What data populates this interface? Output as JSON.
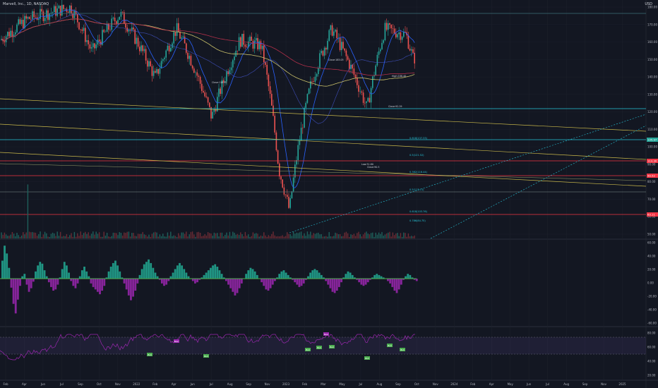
{
  "header": {
    "title": "Marvell, Inc., 1D, NASDAQ",
    "currency": "USD"
  },
  "chart_data": {
    "type": "candlestick",
    "title": "Marvell, Inc., 1D, NASDAQ",
    "x_ticks": [
      "Feb",
      "Apr",
      "Jun",
      "Jul",
      "Sep",
      "Oct",
      "Nov",
      "2022",
      "Feb",
      "Apr",
      "Jun",
      "Jul",
      "Aug",
      "Sep",
      "Nov",
      "2023",
      "Feb",
      "Mar",
      "May",
      "Jul",
      "Aug",
      "Sep",
      "Oct",
      "Nov",
      "2024",
      "Feb",
      "Apr",
      "May",
      "Jun",
      "Jul",
      "Aug",
      "Sep",
      "Nov",
      "2025"
    ],
    "y_axis": {
      "ticks": [
        "180.00",
        "170.00",
        "160.00",
        "150.00",
        "140.00",
        "130.00",
        "120.00",
        "110.00",
        "100.00",
        "90.00",
        "80.00",
        "70.00",
        "60.00",
        "50.00"
      ],
      "scale": "log"
    },
    "price_labels": [
      {
        "text": "135.97",
        "color": "#26a69a"
      },
      {
        "text": "113.30",
        "color": "#f23645"
      },
      {
        "text": "99.52",
        "color": "#f23645"
      },
      {
        "text": "63.11",
        "color": "#f23645"
      }
    ],
    "fib_labels": [
      "0.618(137.33)",
      "0.5(121.52)",
      "0.382(116.44)",
      "0.5(113.11)",
      "0.618(103.76)",
      "0.786(84.75)"
    ],
    "annotations": [
      "Close:183.05",
      "High:186.40",
      "Low:31.80",
      "Close:118.92",
      "Close:90.5",
      "Close:92.29"
    ],
    "macd": {
      "ticks": [
        "60.00",
        "40.00",
        "20.00",
        "0.00",
        "-20.00",
        "-40.00",
        "-60.00"
      ],
      "histogram": [
        30,
        55,
        42,
        18,
        -15,
        -42,
        -58,
        -35,
        -12,
        4,
        8,
        -10,
        -22,
        -16,
        -5,
        12,
        22,
        28,
        25,
        14,
        4,
        -6,
        -14,
        -20,
        -18,
        -10,
        2,
        16,
        28,
        22,
        10,
        -4,
        -12,
        -16,
        -8,
        4,
        14,
        20,
        12,
        4,
        -8,
        -14,
        -18,
        -22,
        -26,
        -20,
        -12,
        2,
        12,
        20,
        26,
        30,
        22,
        12,
        2,
        -8,
        -18,
        -28,
        -36,
        -30,
        -20,
        -8,
        6,
        16,
        24,
        28,
        32,
        26,
        18,
        10,
        4,
        -2,
        -8,
        -12,
        -10,
        -4,
        4,
        10,
        16,
        22,
        26,
        22,
        16,
        10,
        4,
        0,
        -4,
        -8,
        -6,
        -2,
        2,
        6,
        10,
        14,
        18,
        22,
        24,
        20,
        14,
        8,
        2,
        -4,
        -10,
        -16,
        -22,
        -28,
        -24,
        -16,
        -8,
        0,
        8,
        14,
        18,
        16,
        12,
        6,
        0,
        -6,
        -12,
        -18,
        -20,
        -16,
        -10,
        -4,
        2,
        8,
        12,
        14,
        10,
        6,
        2,
        -2,
        -6,
        -10,
        -14,
        -12,
        -8,
        -2,
        4,
        10,
        14,
        16,
        14,
        10,
        6,
        2,
        -4,
        -10,
        -16,
        -22,
        -24,
        -20,
        -14,
        -6,
        2,
        8,
        12,
        10,
        6,
        2,
        -2,
        -6,
        -10,
        -12,
        -10,
        -6,
        -2,
        2,
        6,
        8,
        6,
        4,
        2,
        0,
        -4,
        -8,
        -14,
        -20,
        -24,
        -18,
        -10,
        -2,
        4,
        8,
        6,
        2,
        -2,
        -4
      ]
    },
    "rsi": {
      "ticks": [
        "80.00",
        "60.00",
        "40.00",
        "20.00"
      ],
      "overbought": 70,
      "oversold": 30,
      "signal_labels": [
        {
          "text": "Bear",
          "kind": "bear"
        },
        {
          "text": "Bear",
          "kind": "bear"
        },
        {
          "text": "Bull",
          "kind": "bull"
        },
        {
          "text": "Bull",
          "kind": "bull"
        },
        {
          "text": "Bull",
          "kind": "bull"
        },
        {
          "text": "Bull",
          "kind": "bull"
        },
        {
          "text": "Bull",
          "kind": "bull"
        },
        {
          "text": "Bull",
          "kind": "bull"
        },
        {
          "text": "Bull",
          "kind": "bull"
        },
        {
          "text": "Bull",
          "kind": "bull"
        }
      ]
    }
  },
  "colors": {
    "background": "#131722",
    "grid": "#1e222d",
    "up": "#26a69a",
    "down": "#ef5350",
    "ma_fast": "#2962ff",
    "ma_slow": "#c9c06a",
    "ma_red": "#b2304a",
    "rsi": "#9c27b0",
    "teal_line": "#26c6da",
    "red_line": "#f23645",
    "yellow_line": "#c9b84a"
  }
}
